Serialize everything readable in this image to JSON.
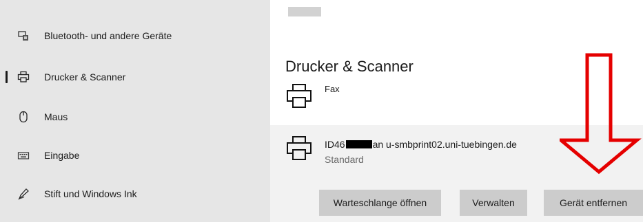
{
  "sidebar": {
    "items": [
      {
        "label": "Bluetooth- und andere Geräte",
        "icon": "bluetooth-devices-icon",
        "selected": false
      },
      {
        "label": "Drucker & Scanner",
        "icon": "printer-icon",
        "selected": true
      },
      {
        "label": "Maus",
        "icon": "mouse-icon",
        "selected": false
      },
      {
        "label": "Eingabe",
        "icon": "keyboard-icon",
        "selected": false
      },
      {
        "label": "Stift und Windows Ink",
        "icon": "pen-icon",
        "selected": false
      }
    ]
  },
  "main": {
    "section_title": "Drucker & Scanner",
    "printers": [
      {
        "name": "Fax",
        "icon": "printer-icon"
      },
      {
        "name_prefix": "ID46",
        "name_suffix": "an u-smbprint02.uni-tuebingen.de",
        "status": "Standard",
        "icon": "printer-icon",
        "selected": true
      }
    ],
    "buttons": {
      "queue": "Warteschlange öffnen",
      "manage": "Verwalten",
      "remove": "Gerät entfernen"
    }
  },
  "annotation": {
    "type": "arrow-down-outline",
    "color": "#e50000"
  },
  "colors": {
    "sidebar_bg": "#e6e6e6",
    "selected_row_bg": "#f2f2f2",
    "button_bg": "#cccccc"
  }
}
